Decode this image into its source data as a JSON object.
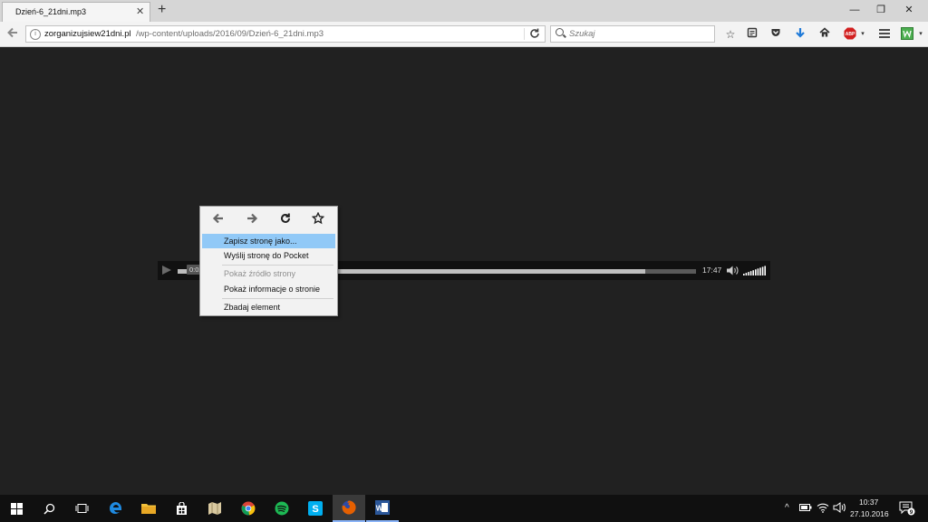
{
  "browser": {
    "tab_title": "Dzień-6_21dni.mp3",
    "tab_close": "✕",
    "new_tab": "+",
    "window": {
      "minimize": "—",
      "restore": "❐",
      "close": "✕"
    }
  },
  "navbar": {
    "url_host": "zorganizujsiew21dni.pl",
    "url_path": "/wp-content/uploads/2016/09/Dzień-6_21dni.mp3",
    "search_placeholder": "Szukaj",
    "abp_label": "ABP",
    "icons": [
      "back-arrow-icon",
      "info-icon",
      "reload-icon",
      "search-icon",
      "bookmark-star-icon",
      "reading-list-icon",
      "pocket-icon",
      "download-icon",
      "home-icon",
      "adblock-plus-icon",
      "menu-hamburger-icon",
      "extension-icon"
    ]
  },
  "player": {
    "current_time": "0:02",
    "duration": "17:47",
    "progress_fraction": 0.902,
    "volume_fraction": 1.0
  },
  "context_menu": {
    "nav": {
      "back": "🡐",
      "forward": "🡒",
      "reload": "↻",
      "bookmark": "☆"
    },
    "items": [
      {
        "label": "Zapisz stronę jako...",
        "highlighted": true
      },
      {
        "label": "Wyślij stronę do Pocket"
      },
      {
        "label": "Pokaż źródło strony",
        "disabled": true
      },
      {
        "label": "Pokaż informacje o stronie"
      },
      {
        "label": "Zbadaj element"
      }
    ]
  },
  "taskbar": {
    "time": "10:37",
    "date": "27.10.2016",
    "notification_count": "9",
    "apps": [
      "windows-start-icon",
      "search-icon",
      "task-view-icon",
      "edge-icon",
      "file-explorer-icon",
      "store-icon",
      "maps-icon",
      "chrome-icon",
      "spotify-icon",
      "skype-icon",
      "firefox-icon",
      "word-icon"
    ]
  },
  "colors": {
    "page_background": "#212121",
    "menu_highlight": "#91c9f7",
    "firefox_orange": "#e66000",
    "spotify_green": "#1db954",
    "skype_blue": "#00aff0"
  }
}
